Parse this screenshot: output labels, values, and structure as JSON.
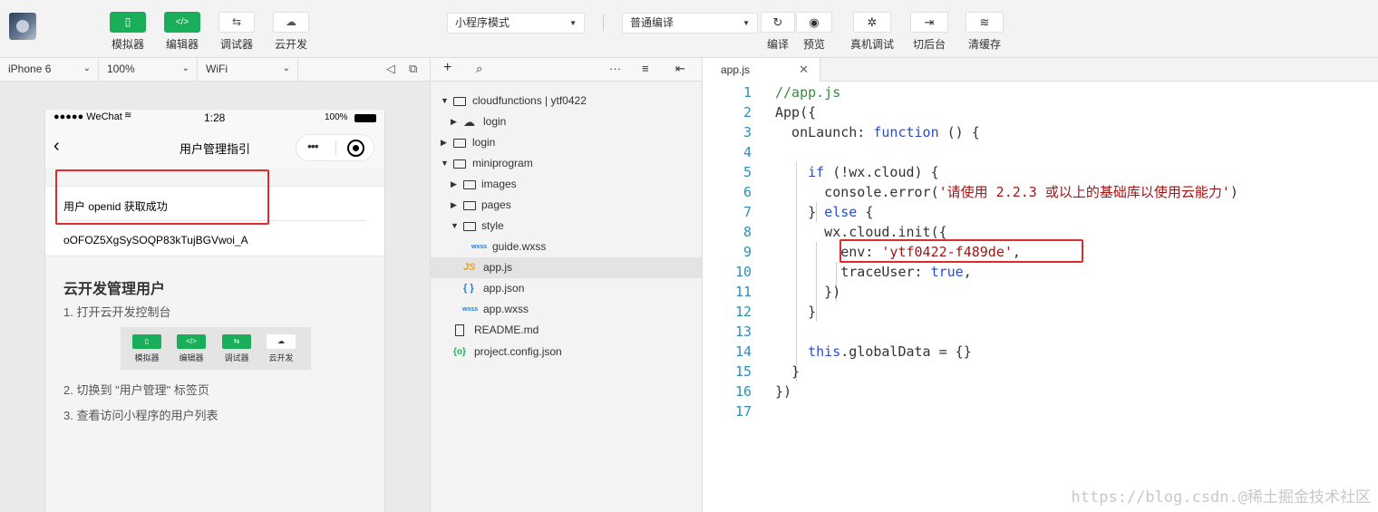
{
  "toolbar": {
    "left_buttons": [
      {
        "label": "模拟器",
        "glyph": "▯"
      },
      {
        "label": "编辑器",
        "glyph": "</>"
      },
      {
        "label": "调试器",
        "glyph": "⇆"
      },
      {
        "label": "云开发",
        "glyph": "☁"
      }
    ],
    "mode_select": "小程序模式",
    "compile_select": "普通编译",
    "right_buttons": [
      {
        "label": "编译",
        "glyph": "↻"
      },
      {
        "label": "预览",
        "glyph": "◉"
      },
      {
        "label": "真机调试",
        "glyph": "✲"
      },
      {
        "label": "切后台",
        "glyph": "⇥"
      },
      {
        "label": "清缓存",
        "glyph": "≋"
      }
    ]
  },
  "simulator": {
    "device": "iPhone 6",
    "zoom": "100%",
    "network": "WiFi",
    "status": {
      "carrier": "●●●●● WeChat",
      "time": "1:28",
      "battery": "100%"
    },
    "nav_title": "用户管理指引",
    "openid_label": "用户 openid 获取成功",
    "openid_value": "oOFOZ5XgSySOQP83kTujBGVwoi_A",
    "section_title": "云开发管理用户",
    "step1": "1. 打开云开发控制台",
    "guide_buttons": [
      "模拟器",
      "编辑器",
      "调试器",
      "云开发"
    ],
    "step2": "2. 切换到 \"用户管理\" 标签页",
    "step3": "3. 查看访问小程序的用户列表"
  },
  "tree": {
    "items": [
      {
        "label": "cloudfunctions | ytf0422",
        "type": "folder-open"
      },
      {
        "label": "login",
        "type": "cloud-folder"
      },
      {
        "label": "login",
        "type": "folder"
      },
      {
        "label": "miniprogram",
        "type": "folder-open"
      },
      {
        "label": "images",
        "type": "folder"
      },
      {
        "label": "pages",
        "type": "folder"
      },
      {
        "label": "style",
        "type": "folder-open"
      },
      {
        "label": "guide.wxss",
        "type": "wxss"
      },
      {
        "label": "app.js",
        "type": "js"
      },
      {
        "label": "app.json",
        "type": "json"
      },
      {
        "label": "app.wxss",
        "type": "wxss"
      },
      {
        "label": "README.md",
        "type": "doc"
      },
      {
        "label": "project.config.json",
        "type": "config"
      }
    ]
  },
  "editor": {
    "tab": "app.js",
    "lines": [
      {
        "n": "1",
        "html": "<span class='c-com'>//app.js</span>"
      },
      {
        "n": "2",
        "html": "App({"
      },
      {
        "n": "3",
        "html": "  onLaunch: <span class='c-kw'>function</span> () {"
      },
      {
        "n": "4",
        "html": ""
      },
      {
        "n": "5",
        "html": "    <span class='c-kw'>if</span> (!wx.cloud) {"
      },
      {
        "n": "6",
        "html": "      console.error(<span class='c-str'>'请使用 2.2.3 或以上的基础库以使用云能力'</span>)"
      },
      {
        "n": "7",
        "html": "    } <span class='c-kw'>else</span> {"
      },
      {
        "n": "8",
        "html": "      wx.cloud.init({"
      },
      {
        "n": "9",
        "html": "        env: <span class='c-str'>'ytf0422-f489de'</span>,"
      },
      {
        "n": "10",
        "html": "        traceUser: <span class='c-kw'>true</span>,"
      },
      {
        "n": "11",
        "html": "      })"
      },
      {
        "n": "12",
        "html": "    }"
      },
      {
        "n": "13",
        "html": ""
      },
      {
        "n": "14",
        "html": "    <span class='c-kw'>this</span>.globalData = {}"
      },
      {
        "n": "15",
        "html": "  }"
      },
      {
        "n": "16",
        "html": "})"
      },
      {
        "n": "17",
        "html": ""
      }
    ]
  },
  "watermark": "https://blog.csdn.@稀土掘金技术社区",
  "colors": {
    "accent": "#1aad5a",
    "highlight": "#e02b2b",
    "keyword": "#2a4bd7",
    "string": "#a31515",
    "comment": "#3a8a3a",
    "line_number": "#2e8eb8"
  }
}
